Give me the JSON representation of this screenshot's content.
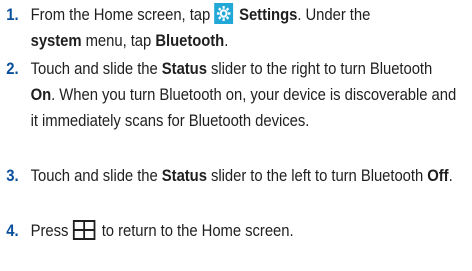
{
  "steps": [
    {
      "number": "1.",
      "parts": {
        "a": "From the Home screen, tap ",
        "b": "Settings",
        "c": ". Under the ",
        "d": "system",
        "e": " menu, tap ",
        "f": "Bluetooth",
        "g": "."
      },
      "icon": "settings-gear-icon"
    },
    {
      "number": "2.",
      "parts": {
        "a": "Touch and slide the ",
        "b": "Status",
        "c": " slider to the right to turn Bluetooth ",
        "d": "On",
        "e": ". When you turn Bluetooth on, your device is discoverable and it immediately scans for Bluetooth devices."
      }
    },
    {
      "number": "3.",
      "parts": {
        "a": "Touch and slide the ",
        "b": "Status",
        "c": " slider to the left to turn Bluetooth ",
        "d": "Off",
        "e": "."
      }
    },
    {
      "number": "4.",
      "parts": {
        "a": "Press ",
        "b": " to return to the Home screen."
      },
      "icon": "windows-start-icon"
    }
  ],
  "colors": {
    "number": "#0a4f9c",
    "settings_icon_bg": "#22a8d6",
    "text": "#1f1f1f"
  }
}
